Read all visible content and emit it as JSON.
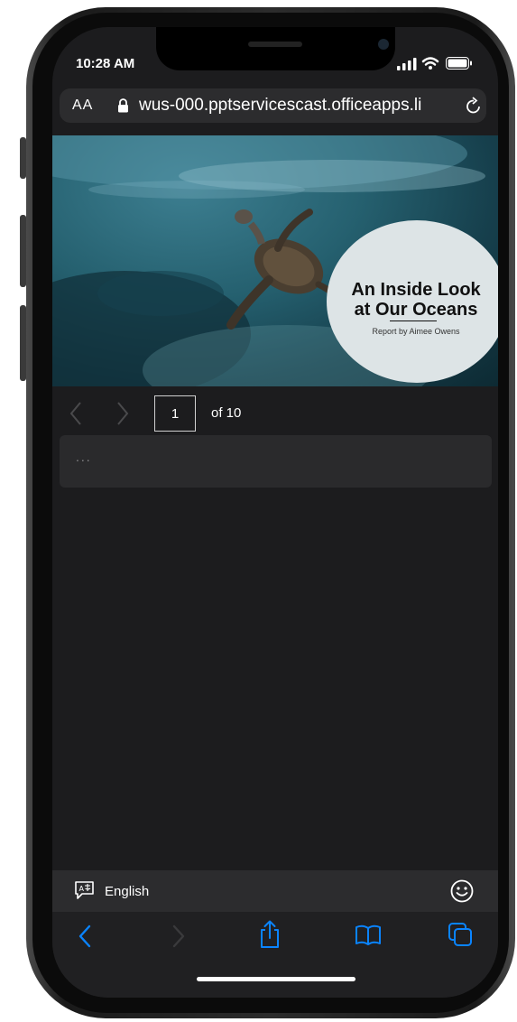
{
  "status": {
    "time": "10:28 AM"
  },
  "browser": {
    "text_size_label": "AA",
    "url": "wus-000.pptservicescast.officeapps.li"
  },
  "slide": {
    "title_line1": "An Inside Look",
    "title_line2": "at Our Oceans",
    "subtitle": "Report by Aimee Owens"
  },
  "pager": {
    "current_page": "1",
    "total_label": "of 10"
  },
  "notes": {
    "placeholder": "..."
  },
  "language_bar": {
    "label": "English"
  },
  "icons": [
    "signal-icon",
    "wifi-icon",
    "battery-icon",
    "lock-icon",
    "reload-icon",
    "prev-slide-icon",
    "next-slide-icon",
    "translate-icon",
    "emoji-icon",
    "back-icon",
    "forward-icon",
    "share-icon",
    "bookmarks-icon",
    "tabs-icon"
  ],
  "colors": {
    "accent": "#0a84ff",
    "screen_bg": "#1c1c1e",
    "bar_bg": "#2c2c2e"
  }
}
